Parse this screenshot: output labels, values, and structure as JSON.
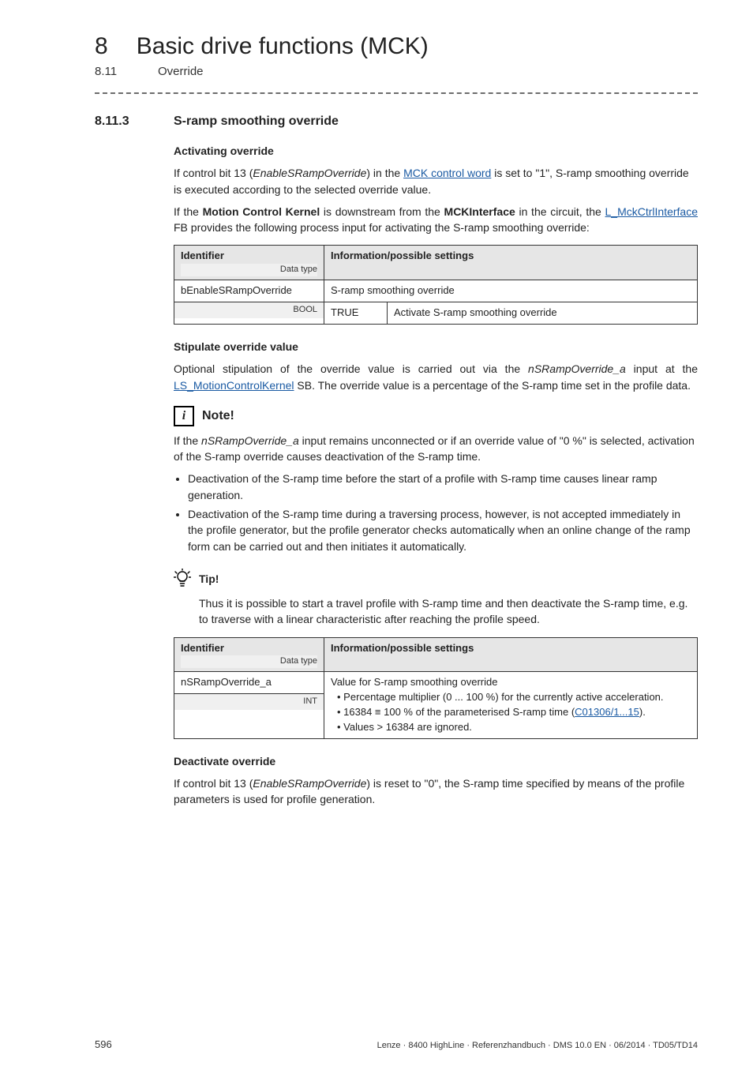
{
  "header": {
    "chapter_num": "8",
    "chapter_title": "Basic drive functions (MCK)",
    "sub_num": "8.11",
    "sub_title": "Override"
  },
  "section": {
    "num": "8.11.3",
    "title": "S-ramp smoothing override"
  },
  "blocks": {
    "activating_head": "Activating override",
    "activating_p1_a": "If control bit 13 (",
    "activating_p1_em": "EnableSRampOverride",
    "activating_p1_b": ") in the ",
    "activating_p1_link": "MCK control word",
    "activating_p1_c": " is set to \"1\", S-ramp smoothing override is executed according to the selected override value.",
    "activating_p2_a": "If the ",
    "activating_p2_bold1": "Motion Control Kernel",
    "activating_p2_b": " is downstream from the ",
    "activating_p2_bold2": "MCKInterface",
    "activating_p2_c": " in the circuit, the ",
    "activating_p2_link": "L_MckCtrlInterface",
    "activating_p2_d": " FB provides the following process input for activating the S-ramp smoothing override:"
  },
  "table1": {
    "head_identifier": "Identifier",
    "head_datatype": "Data type",
    "head_info": "Information/possible settings",
    "row_ident": "bEnableSRampOverride",
    "row_dtype": "BOOL",
    "row_desc": "S-ramp smoothing override",
    "row_val": "TRUE",
    "row_valdesc": "Activate S-ramp smoothing override"
  },
  "stipulate": {
    "head": "Stipulate override value",
    "p_a": "Optional stipulation of the override value is carried out via the ",
    "p_em": "nSRampOverride_a",
    "p_b": " input at the ",
    "p_link": "LS_MotionControlKernel",
    "p_c": " SB. The override value is a percentage of the S-ramp time set in the profile data."
  },
  "note": {
    "label": "Note!",
    "p_a": "If the ",
    "p_em": "nSRampOverride_a",
    "p_b": " input remains unconnected or if an override value of \"0 %\" is selected, activation of the S-ramp override causes deactivation of the S-ramp time.",
    "li1": "Deactivation of the S-ramp time before the start of a profile with S-ramp time causes linear ramp generation.",
    "li2": "Deactivation of the S-ramp time during a traversing process, however, is not accepted immediately in the profile generator, but the profile generator checks automatically when an online change of the ramp form can be carried out and then initiates it automatically."
  },
  "tip": {
    "label": "Tip!",
    "p": "Thus it is possible to start a travel profile with S-ramp time and then deactivate the S-ramp time, e.g. to traverse with a linear characteristic after reaching the profile speed."
  },
  "table2": {
    "head_identifier": "Identifier",
    "head_datatype": "Data type",
    "head_info": "Information/possible settings",
    "row_ident": "nSRampOverride_a",
    "row_dtype": "INT",
    "desc_l1": "Value for S-ramp smoothing override",
    "desc_l2": "• Percentage multiplier (0 ... 100 %) for the currently active acceleration.",
    "desc_l3a": "• 16384 ≡ 100 % of the parameterised S-ramp time (",
    "desc_l3_link": "C01306/1...15",
    "desc_l3b": ").",
    "desc_l4": "• Values > 16384 are ignored."
  },
  "deactivate": {
    "head": "Deactivate override",
    "p_a": "If control bit 13 (",
    "p_em": "EnableSRampOverride",
    "p_b": ") is reset to \"0\", the S-ramp time specified by means of the profile parameters is used for profile generation."
  },
  "footer": {
    "page": "596",
    "doc": "Lenze · 8400 HighLine · Referenzhandbuch · DMS 10.0 EN · 06/2014 · TD05/TD14"
  }
}
